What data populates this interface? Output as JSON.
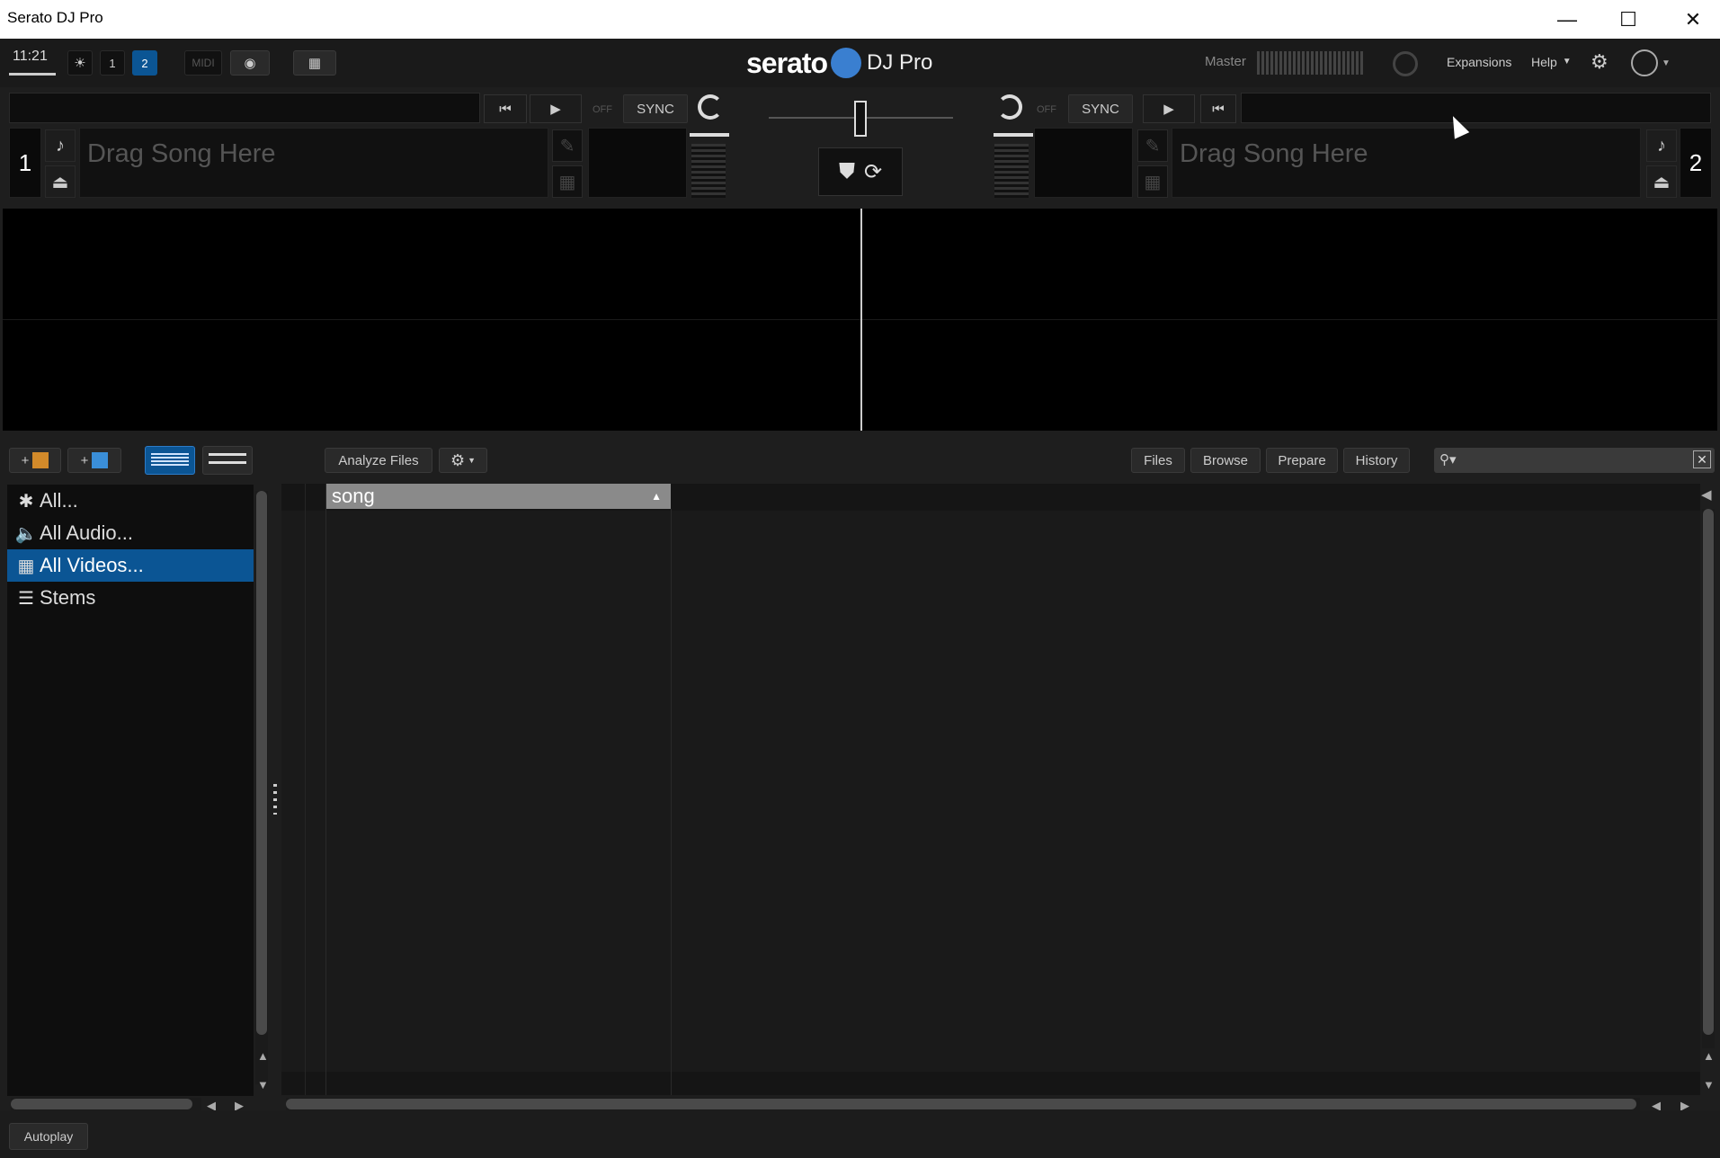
{
  "window": {
    "title": "Serato DJ Pro"
  },
  "topbar": {
    "clock": "11:21",
    "deck_buttons": [
      "1",
      "2"
    ],
    "midi_label": "MIDI",
    "logo": "serato",
    "logo_suffix": "DJ Pro",
    "master_label": "Master",
    "expansions_label": "Expansions",
    "help_label": "Help"
  },
  "decks": {
    "left": {
      "number": "1",
      "drag_text": "Drag Song Here",
      "off_label": "OFF",
      "sync_label": "SYNC"
    },
    "right": {
      "number": "2",
      "drag_text": "Drag Song Here",
      "off_label": "OFF",
      "sync_label": "SYNC"
    }
  },
  "library": {
    "analyze_label": "Analyze Files",
    "tabs": [
      "Files",
      "Browse",
      "Prepare",
      "History"
    ],
    "search_placeholder": "",
    "crates": [
      {
        "label": "All...",
        "icon": "asterisk-icon",
        "selected": false
      },
      {
        "label": "All Audio...",
        "icon": "speaker-icon",
        "selected": false
      },
      {
        "label": "All Videos...",
        "icon": "film-icon",
        "selected": true
      },
      {
        "label": "Stems",
        "icon": "stems-icon",
        "selected": false
      }
    ],
    "columns": [
      {
        "label": "song",
        "sort": "ascending"
      }
    ],
    "sort_indicator": "▲"
  },
  "bottombar": {
    "autoplay_label": "Autoplay"
  },
  "colors": {
    "accent": "#0b5594",
    "background": "#1e1e1e"
  }
}
